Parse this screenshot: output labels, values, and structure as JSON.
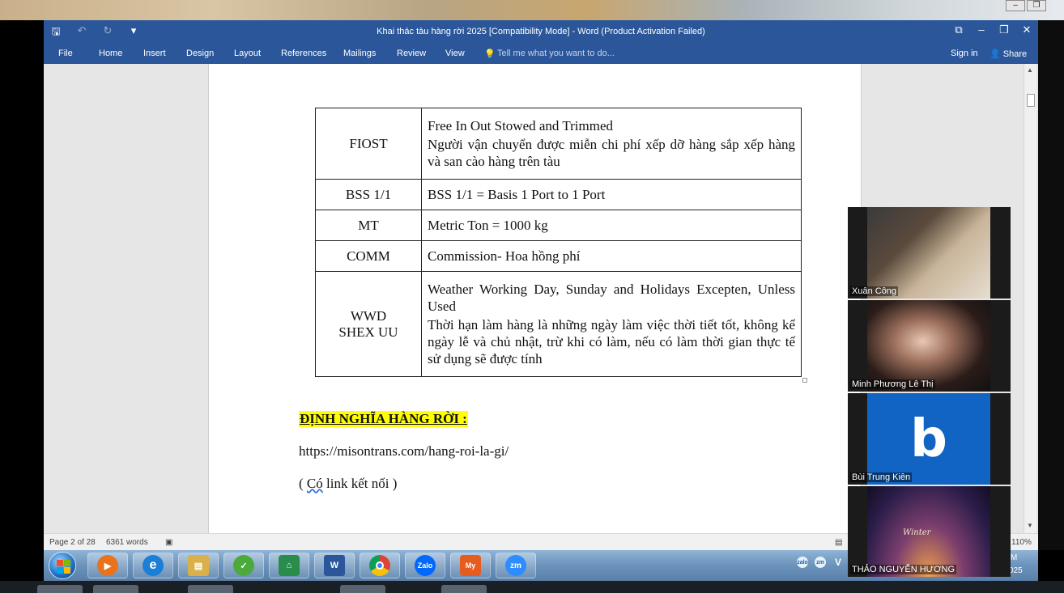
{
  "window": {
    "title": "Khai thác tàu hàng rời 2025 [Compatibility Mode] - Word (Product Activation Failed)",
    "controls": {
      "ribbon_display": "⧉",
      "minimize": "–",
      "restore": "❐",
      "close": "✕"
    }
  },
  "quick_access": {
    "save_icon": "🖫",
    "undo_icon": "↶",
    "redo_icon": "↻",
    "customize_icon": "▾"
  },
  "ribbon": {
    "tabs": [
      "File",
      "Home",
      "Insert",
      "Design",
      "Layout",
      "References",
      "Mailings",
      "Review",
      "View"
    ],
    "tell_me": "Tell me what you want to do...",
    "sign_in": "Sign in",
    "share": "Share"
  },
  "table": [
    {
      "term": "FIOST",
      "defs": [
        "Free In Out Stowed and Trimmed",
        "Người vận chuyển được miễn chi phí xếp dỡ hàng sắp xếp hàng và san cào hàng trên tàu"
      ]
    },
    {
      "term": "BSS 1/1",
      "defs": [
        "BSS 1/1 = Basis 1 Port to 1 Port"
      ]
    },
    {
      "term": "MT",
      "defs": [
        "Metric Ton = 1000 kg"
      ]
    },
    {
      "term": "COMM",
      "defs": [
        "Commission- Hoa hồng phí"
      ]
    },
    {
      "term_line1": "WWD",
      "term_line2": "SHEX UU",
      "defs": [
        "Weather Working Day, Sunday and Holidays Excepten, Unless Used",
        "Thời hạn làm hàng là những ngày làm việc thời tiết tốt, không kể ngày lễ và chủ nhật, trừ khi có làm, nếu có làm thời gian thực tế sử dụng sẽ được tính"
      ]
    }
  ],
  "body": {
    "heading": "ĐỊNH NGHĨA HÀNG RỜI :",
    "link": "https://misontrans.com/hang-roi-la-gi/",
    "note_open": "( ",
    "note_word": "Có",
    "note_rest": " link kết nối )"
  },
  "status": {
    "page": "Page 2 of 28",
    "words": "6361 words",
    "zoom": "110%"
  },
  "taskbar": {
    "apps": [
      {
        "icon": "media-player-icon",
        "label": "▶"
      },
      {
        "icon": "internet-explorer-icon",
        "label": "e"
      },
      {
        "icon": "file-explorer-icon",
        "label": "▤"
      },
      {
        "icon": "green-app-icon",
        "label": "✓"
      },
      {
        "icon": "house-app-icon",
        "label": "⌂"
      },
      {
        "icon": "word-icon",
        "label": "W"
      },
      {
        "icon": "chrome-icon",
        "label": "●"
      },
      {
        "icon": "zalo-icon",
        "label": "Zalo"
      },
      {
        "icon": "mybiz-icon",
        "label": "My"
      },
      {
        "icon": "zoom-icon",
        "label": "zm"
      }
    ],
    "tray": [
      "zalo",
      "zm",
      "V"
    ],
    "clock_frag1": "M",
    "clock_frag2": "025"
  },
  "participants": [
    {
      "name": "Xuân Công"
    },
    {
      "name": "Minh Phương Lê Thị"
    },
    {
      "name": "Bùi Trung Kiên",
      "avatar_letter": "b"
    },
    {
      "name": "THẢO NGUYỄN HƯƠNG",
      "wallpaper_text": "Winter"
    }
  ],
  "colors": {
    "word_blue": "#2b579a",
    "highlight": "#ffff00",
    "zoom_blue": "#1264c4"
  }
}
